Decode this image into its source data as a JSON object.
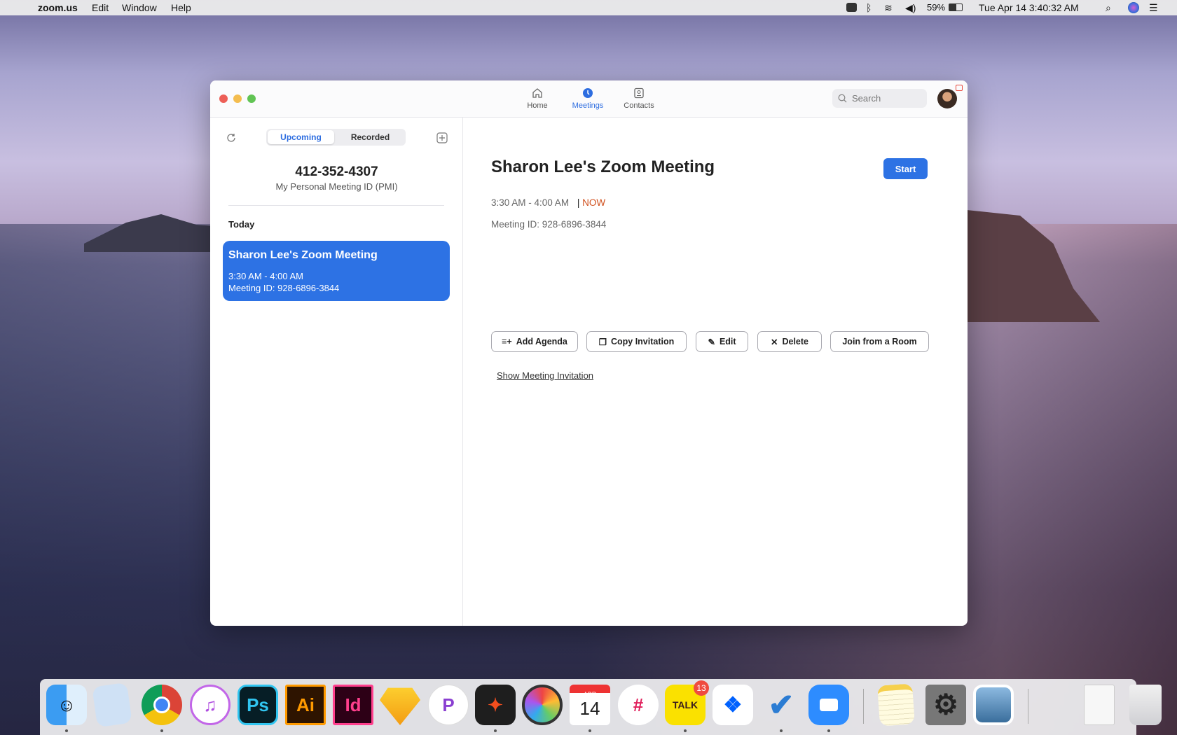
{
  "menubar": {
    "app": "zoom.us",
    "items": [
      "Edit",
      "Window",
      "Help"
    ],
    "battery": "59%",
    "datetime": "Tue Apr 14  3:40:32 AM"
  },
  "window": {
    "nav": [
      {
        "label": "Home"
      },
      {
        "label": "Meetings"
      },
      {
        "label": "Contacts"
      }
    ],
    "search_placeholder": "Search",
    "sidebar": {
      "tabs": [
        "Upcoming",
        "Recorded"
      ],
      "pmi": "412-352-4307",
      "pmi_label": "My Personal Meeting ID (PMI)",
      "section": "Today",
      "card": {
        "title": "Sharon Lee's Zoom Meeting",
        "time": "3:30 AM - 4:00 AM",
        "id": "Meeting ID: 928-6896-3844"
      }
    },
    "detail": {
      "title": "Sharon Lee's Zoom Meeting",
      "start": "Start",
      "time": "3:30 AM - 4:00 AM",
      "sep": "|",
      "now": "NOW",
      "meeting_id": "Meeting ID: 928-6896-3844",
      "buttons": [
        "Add Agenda",
        "Copy Invitation",
        "Edit",
        "Delete",
        "Join from a Room"
      ],
      "show_invitation": "Show Meeting Invitation"
    }
  },
  "dock": {
    "ps": "Ps",
    "ai": "Ai",
    "id": "Id",
    "cal_month": "APR",
    "cal_day": "14",
    "talk": "TALK",
    "badge": "13"
  },
  "colors": {
    "accent": "#2d72e4",
    "now": "#d0501e"
  }
}
